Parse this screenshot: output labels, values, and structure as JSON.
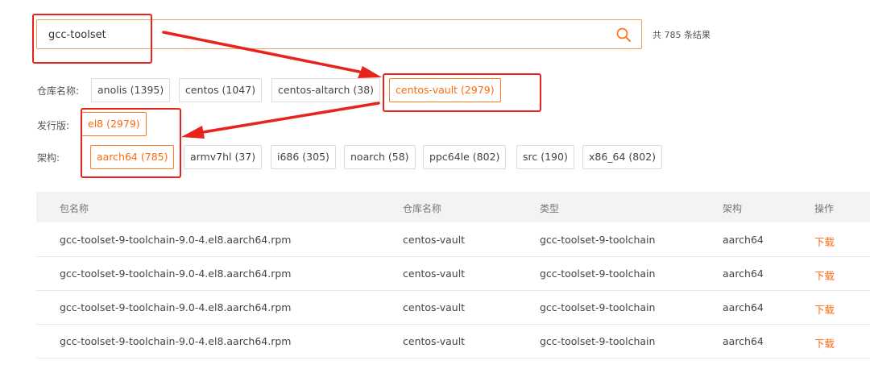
{
  "search": {
    "value": "gcc-toolset",
    "icon": "search-icon",
    "result_count": "共 785 条结果"
  },
  "filters": {
    "repo": {
      "label": "仓库名称:",
      "options": [
        "anolis (1395)",
        "centos (1047)",
        "centos-altarch (38)",
        "centos-vault (2979)"
      ],
      "selected": "centos-vault (2979)"
    },
    "release": {
      "label": "发行版:",
      "options": [
        "el8 (2979)"
      ],
      "selected": "el8 (2979)"
    },
    "arch": {
      "label": "架构:",
      "options": [
        "aarch64 (785)",
        "armv7hl (37)",
        "i686 (305)",
        "noarch (58)",
        "ppc64le (802)",
        "src (190)",
        "x86_64 (802)"
      ],
      "selected": "aarch64 (785)"
    }
  },
  "table": {
    "headers": [
      "包名称",
      "仓库名称",
      "类型",
      "架构",
      "操作"
    ],
    "rows": [
      [
        "gcc-toolset-9-toolchain-9.0-4.el8.aarch64.rpm",
        "centos-vault",
        "gcc-toolset-9-toolchain",
        "aarch64",
        "下载"
      ],
      [
        "gcc-toolset-9-toolchain-9.0-4.el8.aarch64.rpm",
        "centos-vault",
        "gcc-toolset-9-toolchain",
        "aarch64",
        "下载"
      ],
      [
        "gcc-toolset-9-toolchain-9.0-4.el8.aarch64.rpm",
        "centos-vault",
        "gcc-toolset-9-toolchain",
        "aarch64",
        "下载"
      ],
      [
        "gcc-toolset-9-toolchain-9.0-4.el8.aarch64.rpm",
        "centos-vault",
        "gcc-toolset-9-toolchain",
        "aarch64",
        "下载"
      ]
    ]
  },
  "colors": {
    "accent": "#ff6a10",
    "annotation": "#e8231c"
  }
}
